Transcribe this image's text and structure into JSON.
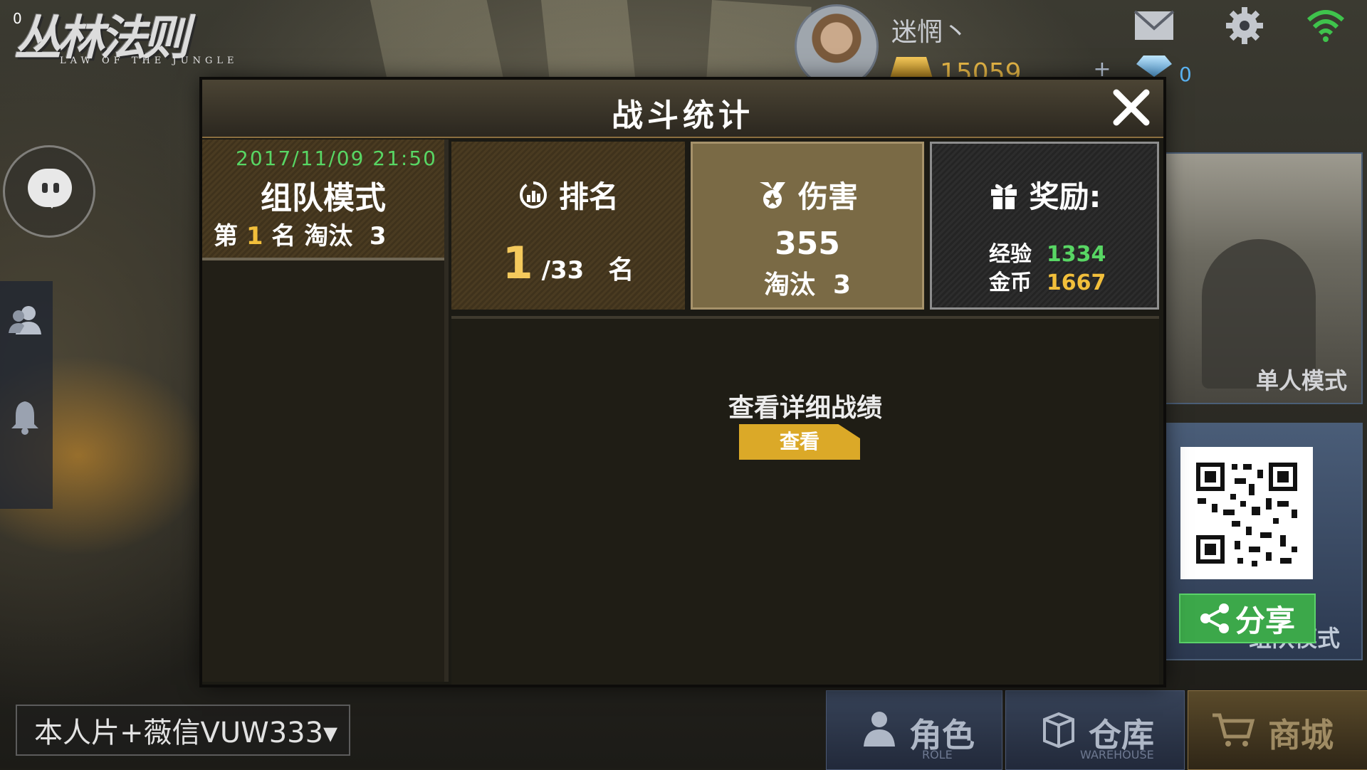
{
  "top_counter": "0",
  "logo": {
    "title_cn": "丛林法则",
    "title_en": "LAW OF THE JUNGLE"
  },
  "player": {
    "name": "迷惘丶",
    "gold": "15059",
    "gem": "0"
  },
  "sidebar": {
    "chat": "chat-icon",
    "friends": "friends-icon",
    "notifications": "bell-icon"
  },
  "mode_cards": {
    "single": "单人模式",
    "team": "组队模式"
  },
  "share": {
    "label": "分享"
  },
  "watermark": {
    "text": "本人片+薇信VUW333▾"
  },
  "bottom_nav": [
    {
      "label": "角色",
      "sub": "ROLE"
    },
    {
      "label": "仓库",
      "sub": "WAREHOUSE"
    },
    {
      "label": "商城",
      "sub": ""
    }
  ],
  "dialog": {
    "title": "战斗统计",
    "match": {
      "date": "2017/11/09 21:50",
      "mode": "组队模式",
      "place_prefix": "第 ",
      "place": "1",
      "place_suffix": " 名 淘汰  3"
    },
    "rank": {
      "label": "排名",
      "value": "1",
      "total": " /33",
      "unit": "名"
    },
    "damage": {
      "label": "伤害",
      "value": "355",
      "kills": "淘汰  3"
    },
    "reward": {
      "label": "奖励:",
      "exp_label": "经验  ",
      "exp": "1334",
      "coin_label": "金币  ",
      "coin": "1667"
    },
    "detail": {
      "label": "查看详细战绩",
      "button": "查看"
    }
  },
  "colors": {
    "accent_gold": "#f2bf3b",
    "accent_green": "#58d664",
    "button_yellow": "#dba928",
    "share_green": "#3ca84a"
  }
}
